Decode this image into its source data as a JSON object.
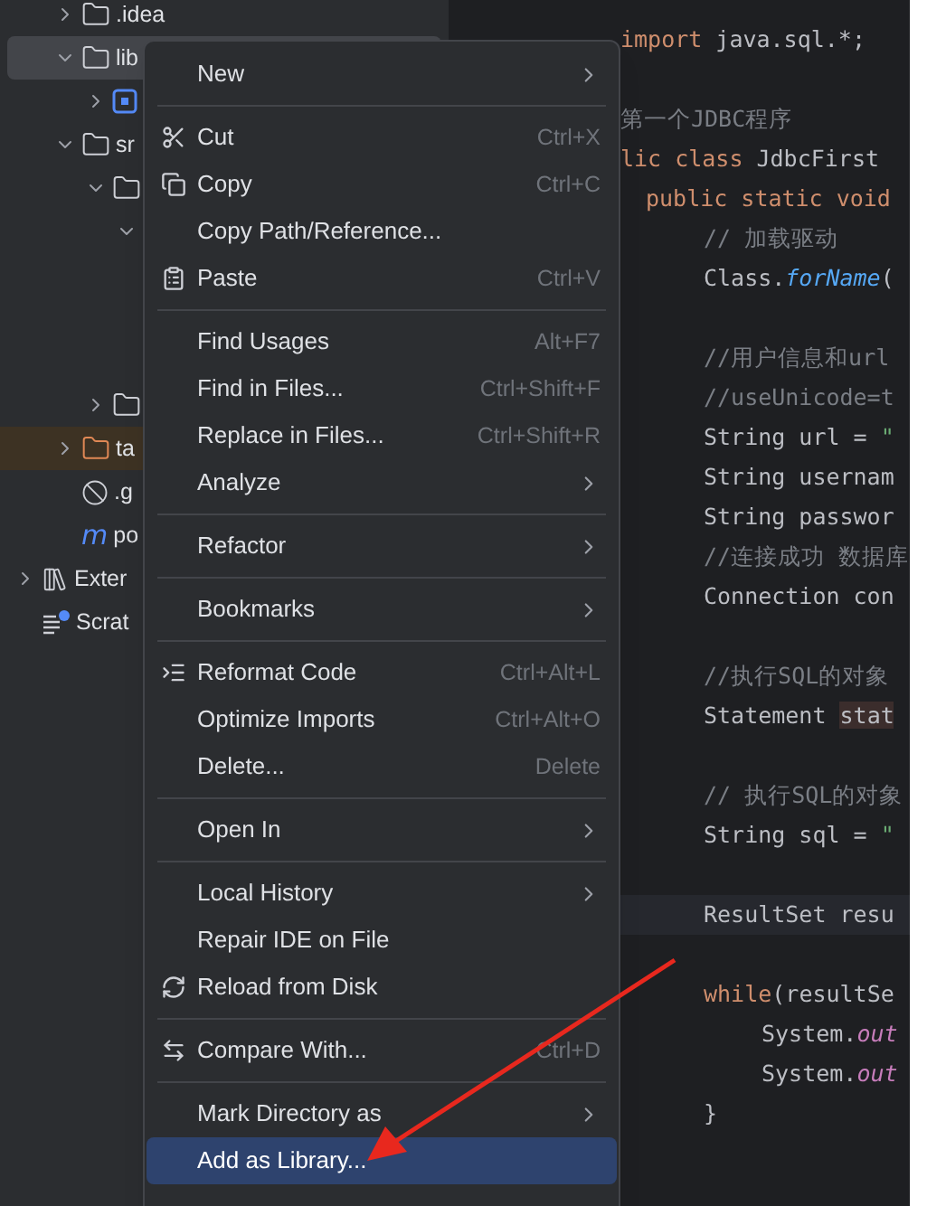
{
  "project_tree": [
    {
      "label": ".idea",
      "kind": "folder",
      "expanded": false,
      "selected": false
    },
    {
      "label": "lib",
      "kind": "folder",
      "expanded": true,
      "selected": true,
      "children": [
        {
          "kind": "module",
          "expanded": false,
          "selected": false
        }
      ]
    },
    {
      "label": "sr",
      "kind": "folder",
      "expanded": true,
      "selected": false,
      "children": [
        {
          "kind": "folder",
          "expanded": true,
          "selected": false,
          "children": [
            {
              "expanded": true,
              "selected": false
            }
          ]
        },
        {
          "kind": "folder",
          "expanded": false,
          "selected": false
        }
      ]
    },
    {
      "label": "ta",
      "kind": "excluded_folder",
      "expanded": false,
      "selected": false
    },
    {
      "label": ".g",
      "kind": "ignore_file",
      "selected": false
    },
    {
      "label": "po",
      "kind": "maven_file",
      "glyph": "m",
      "selected": false
    },
    {
      "label": "Exter",
      "kind": "libraries",
      "expanded": false,
      "selected": false
    },
    {
      "label": "Scrat",
      "kind": "scratches",
      "selected": false
    }
  ],
  "code_lines": [
    {
      "kind": "class",
      "current": false,
      "tokens": [
        {
          "text": "import",
          "kind": "keyword"
        },
        {
          "text": " java.sql.*;",
          "kind": "plain"
        }
      ]
    },
    {
      "kind": "blank",
      "current": false
    },
    {
      "kind": "class",
      "current": false,
      "tokens": [
        {
          "text": "第一个JDBC程序",
          "kind": "comment"
        }
      ]
    },
    {
      "kind": "class",
      "current": false,
      "tokens": [
        {
          "text": "lic class",
          "kind": "keyword"
        },
        {
          "text": " JdbcFirst",
          "kind": "plain"
        }
      ]
    },
    {
      "kind": "method",
      "current": false,
      "tokens": [
        {
          "text": "public static void",
          "kind": "keyword"
        }
      ]
    },
    {
      "kind": "body",
      "current": false,
      "tokens": [
        {
          "text": "// 加载驱动",
          "kind": "comment"
        }
      ]
    },
    {
      "kind": "body",
      "current": false,
      "tokens": [
        {
          "text": "Class.",
          "kind": "plain"
        },
        {
          "text": "forName",
          "kind": "italic"
        },
        {
          "text": "(",
          "kind": "plain"
        }
      ]
    },
    {
      "kind": "blank",
      "current": false
    },
    {
      "kind": "body",
      "current": false,
      "tokens": [
        {
          "text": "//用户信息和url",
          "kind": "comment"
        }
      ]
    },
    {
      "kind": "body",
      "current": false,
      "tokens": [
        {
          "text": "//useUnicode=t",
          "kind": "comment"
        }
      ]
    },
    {
      "kind": "body",
      "current": false,
      "tokens": [
        {
          "text": "String url = ",
          "kind": "plain"
        },
        {
          "text": "\"",
          "kind": "string"
        }
      ]
    },
    {
      "kind": "body",
      "current": false,
      "tokens": [
        {
          "text": "String usernam",
          "kind": "plain"
        }
      ]
    },
    {
      "kind": "body",
      "current": false,
      "tokens": [
        {
          "text": "String passwor",
          "kind": "plain"
        }
      ]
    },
    {
      "kind": "body",
      "current": false,
      "tokens": [
        {
          "text": "//连接成功 数据库",
          "kind": "comment"
        }
      ]
    },
    {
      "kind": "body",
      "current": false,
      "tokens": [
        {
          "text": "Connection con",
          "kind": "plain"
        }
      ]
    },
    {
      "kind": "blank",
      "current": false
    },
    {
      "kind": "body",
      "current": false,
      "tokens": [
        {
          "text": "//执行SQL的对象",
          "kind": "comment"
        }
      ]
    },
    {
      "kind": "body",
      "current": false,
      "tokens": [
        {
          "text": "Statement ",
          "kind": "plain"
        },
        {
          "text": "stat",
          "kind": "highlight"
        }
      ]
    },
    {
      "kind": "blank",
      "current": false
    },
    {
      "kind": "body",
      "current": false,
      "tokens": [
        {
          "text": "// 执行SQL的对象",
          "kind": "comment"
        }
      ]
    },
    {
      "kind": "body",
      "current": false,
      "tokens": [
        {
          "text": "String sql = ",
          "kind": "plain"
        },
        {
          "text": "\"",
          "kind": "string"
        }
      ]
    },
    {
      "kind": "blank",
      "current": false
    },
    {
      "kind": "body",
      "current": true,
      "tokens": [
        {
          "text": "ResultSet resu",
          "kind": "plain"
        }
      ]
    },
    {
      "kind": "blank",
      "current": false
    },
    {
      "kind": "body",
      "current": false,
      "tokens": [
        {
          "text": "while",
          "kind": "keyword"
        },
        {
          "text": "(resultSe",
          "kind": "plain"
        }
      ]
    },
    {
      "kind": "inner",
      "current": false,
      "tokens": [
        {
          "text": "System.",
          "kind": "plain"
        },
        {
          "text": "out",
          "kind": "field"
        }
      ]
    },
    {
      "kind": "inner",
      "current": false,
      "tokens": [
        {
          "text": "System.",
          "kind": "plain"
        },
        {
          "text": "out",
          "kind": "field"
        }
      ]
    },
    {
      "kind": "body",
      "current": false,
      "tokens": [
        {
          "text": "}",
          "kind": "plain"
        }
      ]
    }
  ],
  "context_menu": {
    "groups": [
      [
        {
          "label": "New",
          "kind": "plain",
          "submenu": true,
          "selected": false
        }
      ],
      [
        {
          "label": "Cut",
          "kind": "cut",
          "shortcut": "Ctrl+X",
          "submenu": false,
          "selected": false
        },
        {
          "label": "Copy",
          "kind": "copy",
          "shortcut": "Ctrl+C",
          "submenu": false,
          "selected": false
        },
        {
          "label": "Copy Path/Reference...",
          "kind": "plain",
          "submenu": false,
          "selected": false
        },
        {
          "label": "Paste",
          "kind": "paste",
          "shortcut": "Ctrl+V",
          "submenu": false,
          "selected": false
        }
      ],
      [
        {
          "label": "Find Usages",
          "kind": "plain",
          "shortcut": "Alt+F7",
          "submenu": false,
          "selected": false
        },
        {
          "label": "Find in Files...",
          "kind": "plain",
          "shortcut": "Ctrl+Shift+F",
          "submenu": false,
          "selected": false
        },
        {
          "label": "Replace in Files...",
          "kind": "plain",
          "shortcut": "Ctrl+Shift+R",
          "submenu": false,
          "selected": false
        },
        {
          "label": "Analyze",
          "kind": "plain",
          "submenu": true,
          "selected": false
        }
      ],
      [
        {
          "label": "Refactor",
          "kind": "plain",
          "submenu": true,
          "selected": false
        }
      ],
      [
        {
          "label": "Bookmarks",
          "kind": "plain",
          "submenu": true,
          "selected": false
        }
      ],
      [
        {
          "label": "Reformat Code",
          "kind": "reformat",
          "shortcut": "Ctrl+Alt+L",
          "submenu": false,
          "selected": false
        },
        {
          "label": "Optimize Imports",
          "kind": "plain",
          "shortcut": "Ctrl+Alt+O",
          "submenu": false,
          "selected": false
        },
        {
          "label": "Delete...",
          "kind": "plain",
          "shortcut": "Delete",
          "submenu": false,
          "selected": false
        }
      ],
      [
        {
          "label": "Open In",
          "kind": "plain",
          "submenu": true,
          "selected": false
        }
      ],
      [
        {
          "label": "Local History",
          "kind": "plain",
          "submenu": true,
          "selected": false
        },
        {
          "label": "Repair IDE on File",
          "kind": "plain",
          "submenu": false,
          "selected": false
        },
        {
          "label": "Reload from Disk",
          "kind": "reload",
          "submenu": false,
          "selected": false
        }
      ],
      [
        {
          "label": "Compare With...",
          "kind": "compare",
          "shortcut": "Ctrl+D",
          "submenu": false,
          "selected": false
        }
      ],
      [
        {
          "label": "Mark Directory as",
          "kind": "plain",
          "submenu": true,
          "selected": false
        },
        {
          "label": "Add as Library...",
          "kind": "plain",
          "submenu": false,
          "selected": true
        }
      ]
    ]
  },
  "annotation": {
    "kind": "arrow",
    "color": "#e8281e"
  }
}
